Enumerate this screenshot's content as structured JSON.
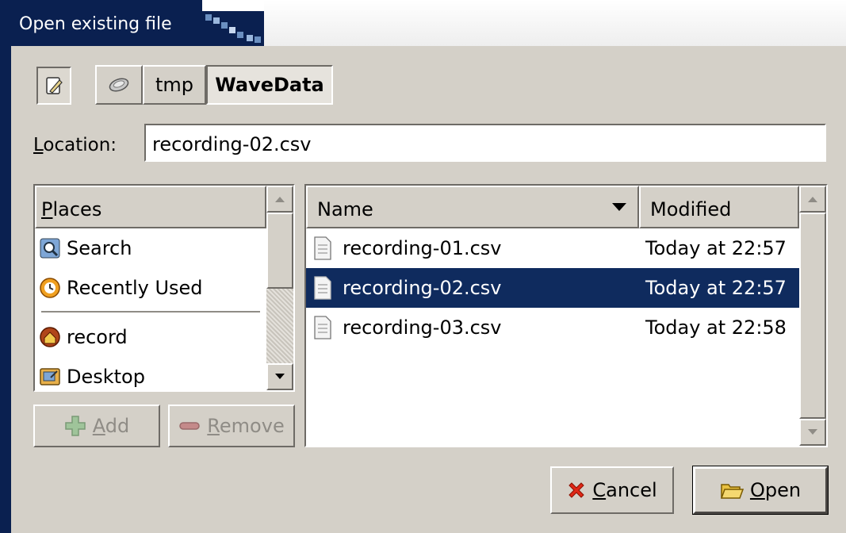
{
  "window": {
    "title": "Open existing file"
  },
  "pathbar": {
    "segments": [
      {
        "label": "tmp"
      },
      {
        "label": "WaveData"
      }
    ]
  },
  "location": {
    "label_mnemonic": "L",
    "label_rest": "ocation:",
    "value": "recording-02.csv"
  },
  "places": {
    "header_mnemonic": "P",
    "header_rest": "laces",
    "items": [
      {
        "label": "Search",
        "icon": "search-icon"
      },
      {
        "label": "Recently Used",
        "icon": "recent-icon"
      },
      {
        "label": "record",
        "icon": "home-icon"
      },
      {
        "label": "Desktop",
        "icon": "desktop-icon"
      }
    ],
    "add_mnemonic": "A",
    "add_rest": "dd",
    "remove_mnemonic": "R",
    "remove_rest": "emove"
  },
  "files": {
    "columns": {
      "name": "Name",
      "modified": "Modified"
    },
    "rows": [
      {
        "name": "recording-01.csv",
        "modified": "Today at 22:57",
        "selected": false
      },
      {
        "name": "recording-02.csv",
        "modified": "Today at 22:57",
        "selected": true
      },
      {
        "name": "recording-03.csv",
        "modified": "Today at 22:58",
        "selected": false
      }
    ]
  },
  "actions": {
    "cancel_mnemonic": "C",
    "cancel_rest": "ancel",
    "open_mnemonic": "O",
    "open_rest": "pen"
  },
  "colors": {
    "titlebar": "#0a2050",
    "selection": "#0f2b5e",
    "dialog_bg": "#d4d0c8"
  }
}
